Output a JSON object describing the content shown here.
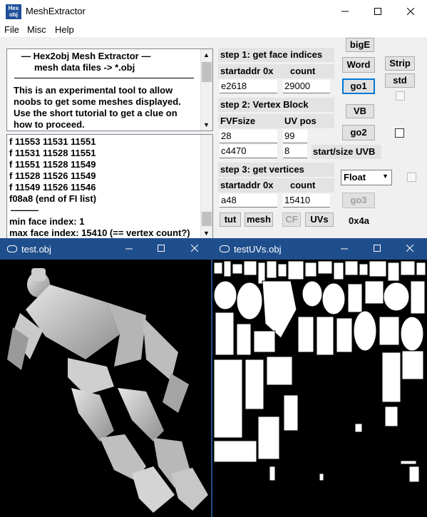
{
  "main_window": {
    "icon_text_top": "Hex",
    "icon_text_bottom": "obj",
    "title": "MeshExtractor",
    "menu": [
      "File",
      "Misc",
      "Help"
    ]
  },
  "info_box": {
    "lines": [
      "—   Hex2obj Mesh Extractor   —",
      "mesh data files -> *.obj",
      "This is an experimental tool to allow",
      "noobs to get some meshes displayed.",
      "Use the short tutorial to get a clue on",
      "how to proceed."
    ]
  },
  "log_box": {
    "lines": [
      "f  11553 11531 11551",
      "f  11531 11528 11551",
      "f  11551 11528 11549",
      "f  11528 11526 11549",
      "f  11549 11526 11546",
      "f08a8 (end of FI list)",
      "———",
      "min face index: 1",
      "max face index: 15410 (== vertex count?)"
    ]
  },
  "step1": {
    "label": "step 1: get face indices",
    "startaddr_label": "startaddr 0x",
    "count_label": "count",
    "startaddr_value": "e2618",
    "count_value": "29000"
  },
  "step2": {
    "label": "step 2: Vertex Block",
    "fvf_label": "FVFsize",
    "uvpos_label": "UV pos",
    "fvf_value": "28",
    "uvpos_value": "99",
    "uvb_start_value": "c4470",
    "uvb_size_value": "8",
    "uvb_label": "start/size UVB"
  },
  "step3": {
    "label": "step 3: get vertices",
    "startaddr_label": "startaddr 0x",
    "count_label": "count",
    "startaddr_value": "a48",
    "count_value": "15410"
  },
  "buttons": {
    "bigE": "bigE",
    "word": "Word",
    "go1": "go1",
    "strip": "Strip",
    "std": "std",
    "vb": "VB",
    "go2": "go2",
    "go3": "go3",
    "tut": "tut",
    "mesh": "mesh",
    "cf": "CF",
    "uvs": "UVs"
  },
  "format_select": "Float",
  "hex_readout": "0x4a",
  "windows": {
    "left_title": "test.obj",
    "right_title": "testUVs.obj"
  }
}
